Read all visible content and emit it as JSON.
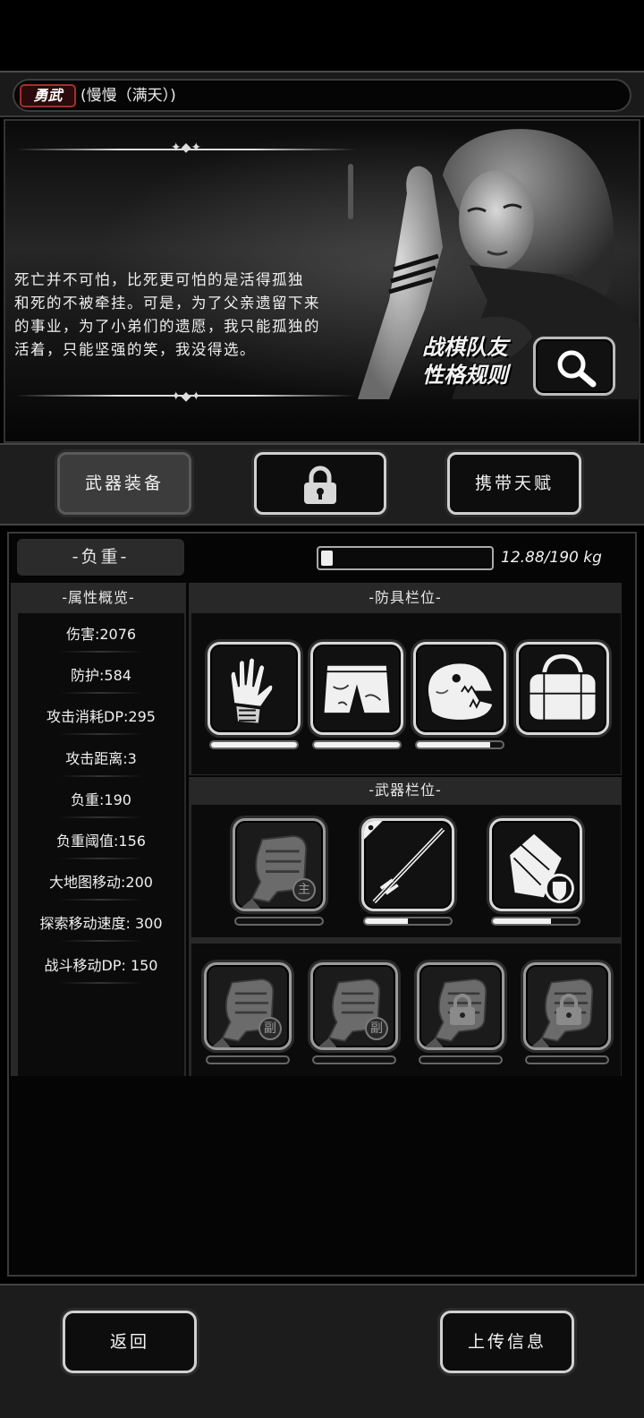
{
  "header": {
    "trait_badge": "勇武",
    "character_name": "(慢慢（满天）)"
  },
  "story": {
    "lines": [
      "死亡并不可怕，比死更可怕的是活得孤独",
      "和死的不被牵挂。可是，为了父亲遗留下来",
      "的事业，为了小弟们的遗愿，我只能孤独的",
      "活着，只能坚强的笑，我没得选。"
    ],
    "rule_label_line1": "战棋队友",
    "rule_label_line2": "性格规则"
  },
  "tabs": {
    "weapon": "武器装备",
    "talent": "携带天赋"
  },
  "load": {
    "label": "-负重-",
    "current_kg": 12.88,
    "max_kg": 190,
    "text": "12.88/190 kg"
  },
  "stats": {
    "header": "-属性概览-",
    "items": [
      "伤害:2076",
      "防护:584",
      "攻击消耗DP:295",
      "攻击距离:3",
      "负重:190",
      "负重阈值:156",
      "大地图移动:200",
      "探索移动速度: 300",
      "战斗移动DP: 150"
    ]
  },
  "armor": {
    "header": "-防具栏位-",
    "slots": [
      {
        "icon": "gloves-icon",
        "durability": 1.0
      },
      {
        "icon": "shorts-icon",
        "durability": 1.0
      },
      {
        "icon": "dinosaur-mask-icon",
        "durability": 0.85
      },
      {
        "icon": "duffel-bag-icon",
        "durability": null
      }
    ]
  },
  "weapons": {
    "header": "-武器栏位-",
    "slots": [
      {
        "icon": "fist-icon",
        "tag": "主",
        "durability": 0.0
      },
      {
        "icon": "spear-icon",
        "tag": "",
        "durability": 0.5
      },
      {
        "icon": "shield-case-icon",
        "tag": "",
        "durability": 0.68
      }
    ],
    "sub_slots": [
      {
        "icon": "fist-icon",
        "tag": "副",
        "locked": false
      },
      {
        "icon": "fist-icon",
        "tag": "副",
        "locked": false
      },
      {
        "icon": "fist-icon",
        "tag": "",
        "locked": true
      },
      {
        "icon": "fist-icon",
        "tag": "",
        "locked": true
      }
    ]
  },
  "footer": {
    "back": "返回",
    "upload": "上传信息"
  }
}
